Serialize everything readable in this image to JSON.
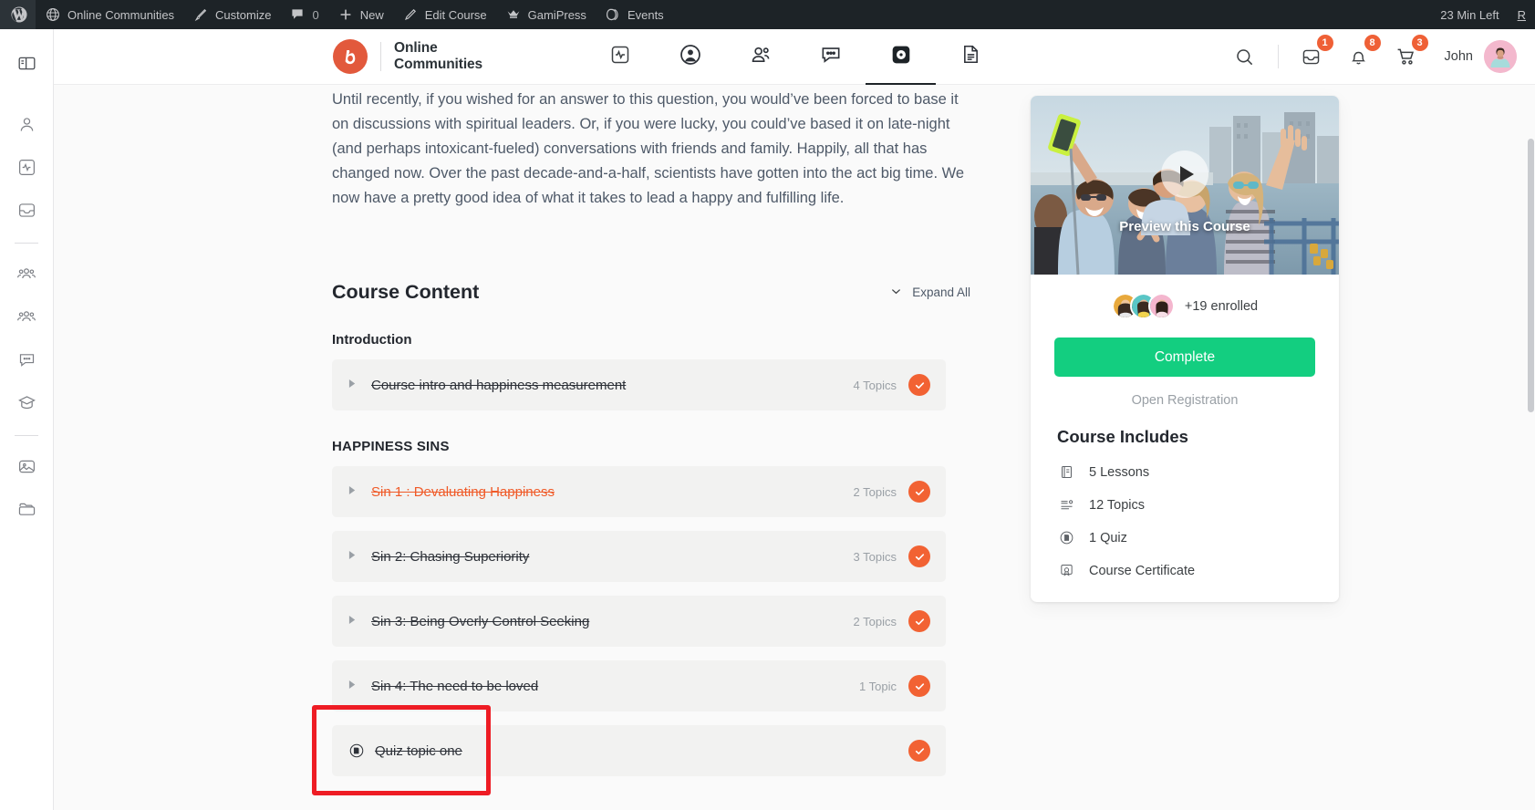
{
  "adminbar": {
    "logo_icon": "wordpress-icon",
    "items": [
      {
        "icon": "site-icon",
        "label": "Online Communities"
      },
      {
        "icon": "brush-icon",
        "label": "Customize"
      },
      {
        "icon": "comment-icon",
        "label": "",
        "count": "0"
      },
      {
        "icon": "plus-icon",
        "label": "New"
      },
      {
        "icon": "pencil-icon",
        "label": "Edit Course"
      },
      {
        "icon": "crown-icon",
        "label": "GamiPress"
      },
      {
        "icon": "ticket-icon",
        "label": "Events"
      }
    ],
    "right_text": "23 Min Left",
    "right_link": "R"
  },
  "leftrail": {
    "items": [
      {
        "name": "panel-toggle-icon",
        "icon": "panel"
      },
      {
        "name": "profile-icon",
        "icon": "person"
      },
      {
        "name": "activity-icon",
        "icon": "activity"
      },
      {
        "name": "inbox-icon",
        "icon": "inbox"
      },
      {
        "name": "divider-1",
        "icon": "divider"
      },
      {
        "name": "members-icon",
        "icon": "group"
      },
      {
        "name": "groups-icon",
        "icon": "group"
      },
      {
        "name": "messages-icon",
        "icon": "chat"
      },
      {
        "name": "courses-icon",
        "icon": "cap"
      },
      {
        "name": "divider-2",
        "icon": "divider"
      },
      {
        "name": "media-icon",
        "icon": "image"
      },
      {
        "name": "documents-icon",
        "icon": "folder"
      }
    ]
  },
  "header": {
    "brand_line1": "Online",
    "brand_line2": "Communities",
    "brand_mark": "bb-logo-icon",
    "nav": [
      {
        "name": "nav-activity",
        "icon": "activity-box-icon",
        "active": false
      },
      {
        "name": "nav-profile",
        "icon": "user-circle-icon",
        "active": false
      },
      {
        "name": "nav-members",
        "icon": "members-icon",
        "active": false
      },
      {
        "name": "nav-messages",
        "icon": "chat-bubble-icon",
        "active": false
      },
      {
        "name": "nav-courses",
        "icon": "courses-icon",
        "active": true
      },
      {
        "name": "nav-documents",
        "icon": "document-icon",
        "active": false
      }
    ],
    "search_icon": "search-icon",
    "inbox_badge": "1",
    "bell_badge": "8",
    "cart_badge": "3",
    "username": "John"
  },
  "main": {
    "paragraph": "Until recently, if you wished for an answer to this question, you would’ve been forced to base it on discussions with spiritual leaders. Or, if you were lucky, you could’ve based it on late-night (and perhaps intoxicant-fueled) conversations with friends and family. Happily, all that has changed now. Over the past decade-and-a-half, scientists have gotten into the act big time. We now have a pretty good idea of what it takes to lead a happy and fulfilling life.",
    "course_content_title": "Course Content",
    "expand_all": "Expand All",
    "sections": [
      {
        "title": "Introduction",
        "caps": false,
        "rows": [
          {
            "title": "Course intro and happiness measurement",
            "topics": "4 Topics",
            "type": "lesson",
            "highlight": false,
            "completed": true
          }
        ]
      },
      {
        "title": "HAPPINESS SINS",
        "caps": true,
        "rows": [
          {
            "title": "Sin 1 : Devaluating Happiness",
            "topics": "2 Topics",
            "type": "lesson",
            "highlight": true,
            "completed": true
          },
          {
            "title": "Sin 2: Chasing Superiority",
            "topics": "3 Topics",
            "type": "lesson",
            "highlight": false,
            "completed": true
          },
          {
            "title": "Sin 3: Being Overly Control Seeking",
            "topics": "2 Topics",
            "type": "lesson",
            "highlight": false,
            "completed": true
          },
          {
            "title": "Sin 4: The need to be loved",
            "topics": "1 Topic",
            "type": "lesson",
            "highlight": false,
            "completed": true
          },
          {
            "title": "Quiz topic one",
            "topics": "",
            "type": "quiz",
            "highlight": false,
            "completed": true,
            "annotated": true
          }
        ]
      }
    ]
  },
  "sidebar": {
    "preview_label": "Preview this Course",
    "play_icon": "play-icon",
    "enrolled_text": "+19 enrolled",
    "complete_button": "Complete",
    "registration_status": "Open Registration",
    "includes_title": "Course Includes",
    "includes": [
      {
        "icon": "lessons-icon",
        "label": "5 Lessons"
      },
      {
        "icon": "topics-icon",
        "label": "12 Topics"
      },
      {
        "icon": "quiz-icon",
        "label": "1 Quiz"
      },
      {
        "icon": "certificate-icon",
        "label": "Course Certificate"
      }
    ]
  },
  "colors": {
    "accent_orange": "#f26233",
    "brand_red": "#e2593c",
    "complete_green": "#13ce80",
    "annotation_red": "#ee1c24",
    "adminbar_bg": "#1d2327"
  }
}
